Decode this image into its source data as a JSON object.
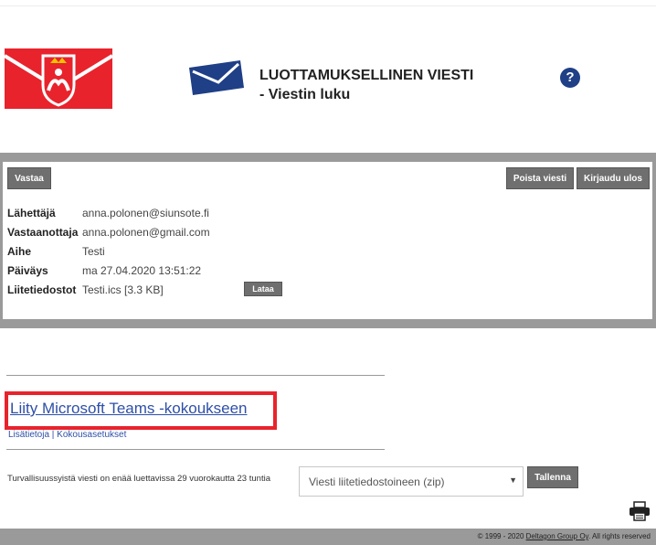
{
  "header": {
    "title_line1": "LUOTTAMUKSELLINEN VIESTI",
    "title_line2": "- Viestin luku",
    "help_glyph": "?",
    "help_icon": "question-circle-icon",
    "logo_icon": "coat-of-arms-icon",
    "envelope_icon": "envelope-icon"
  },
  "toolbar": {
    "reply_label": "Vastaa",
    "delete_label": "Poista viesti",
    "logout_label": "Kirjaudu ulos"
  },
  "message": {
    "fields": [
      {
        "label": "Lähettäjä",
        "value": "anna.polonen@siunsote.fi"
      },
      {
        "label": "Vastaanottaja",
        "value": "anna.polonen@gmail.com"
      },
      {
        "label": "Aihe",
        "value": "Testi"
      },
      {
        "label": "Päiväys",
        "value": "ma 27.04.2020 13:51:22"
      },
      {
        "label": "Liitetiedostot",
        "value": "Testi.ics [3.3 KB]"
      }
    ],
    "download_label": "Lataa"
  },
  "body": {
    "teams_link": "Liity Microsoft Teams -kokoukseen",
    "secondary_links": "Lisätietoja | Kokousasetukset"
  },
  "bottom": {
    "retention_text": "Turvallisuussyistä viesti on enää luettavissa 29 vuorokautta 23 tuntia",
    "download_select": "Viesti liitetiedostoineen (zip)",
    "save_label": "Tallenna",
    "printer_icon": "printer-icon"
  },
  "footer": {
    "copyright_prefix": "© 1999 - 2020 ",
    "company": "Deltagon Group Oy",
    "rights": ". All rights reserved"
  },
  "colors": {
    "brand_red": "#e8232c",
    "envelope_blue": "#1f3f86",
    "band_gray": "#9a9a9a",
    "button_gray": "#6f6f6f",
    "link_blue": "#2e4fa8"
  }
}
